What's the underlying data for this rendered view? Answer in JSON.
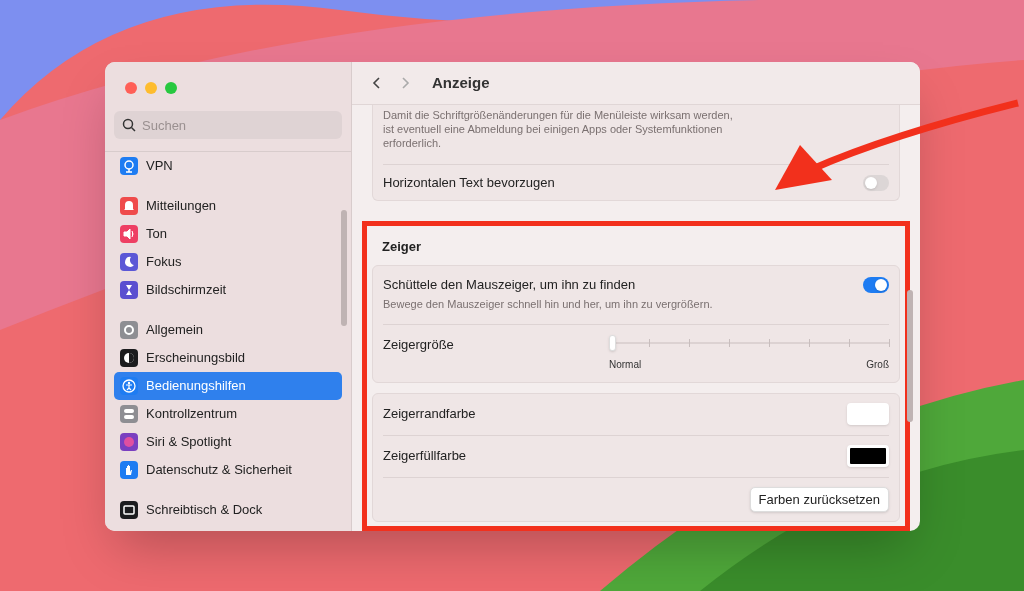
{
  "window": {
    "title": "Anzeige"
  },
  "search": {
    "placeholder": "Suchen"
  },
  "sidebar": {
    "groups": [
      [
        {
          "label": "VPN",
          "color": "#1e7cf2",
          "selected": false
        }
      ],
      [
        {
          "label": "Mitteilungen",
          "color": "#ef4b4b",
          "selected": false
        },
        {
          "label": "Ton",
          "color": "#ee3f63",
          "selected": false
        },
        {
          "label": "Fokus",
          "color": "#5b57d6",
          "selected": false
        },
        {
          "label": "Bildschirmzeit",
          "color": "#5b4fd0",
          "selected": false
        }
      ],
      [
        {
          "label": "Allgemein",
          "color": "#8e8e93",
          "selected": false
        },
        {
          "label": "Erscheinungsbild",
          "color": "#1c1c1e",
          "selected": false
        },
        {
          "label": "Bedienungshilfen",
          "color": "#1e7cf2",
          "selected": true
        },
        {
          "label": "Kontrollzentrum",
          "color": "#8e8e93",
          "selected": false
        },
        {
          "label": "Siri & Spotlight",
          "color": "#7a3fc0",
          "selected": false
        },
        {
          "label": "Datenschutz & Sicherheit",
          "color": "#1e7cf2",
          "selected": false
        }
      ],
      [
        {
          "label": "Schreibtisch & Dock",
          "color": "#1c1c1e",
          "selected": false
        }
      ]
    ]
  },
  "top_card": {
    "note": "Damit die Schriftgrößenänderungen für die Menüleiste wirksam werden, ist eventuell eine Abmeldung bei einigen Apps oder Systemfunktionen erforderlich.",
    "toggle": {
      "label": "Horizontalen Text bevorzugen",
      "on": false
    }
  },
  "pointer_section": {
    "title": "Zeiger",
    "shake": {
      "label": "Schüttele den Mauszeiger, um ihn zu finden",
      "description": "Bewege den Mauszeiger schnell hin und her, um ihn zu vergrößern.",
      "on": true
    },
    "size": {
      "label": "Zeigergröße",
      "level": 0,
      "min_label": "Normal",
      "max_label": "Groß"
    },
    "colors": [
      {
        "label": "Zeigerrandfarbe",
        "color": "#ffffff"
      },
      {
        "label": "Zeigerfüllfarbe",
        "color": "#000000"
      }
    ],
    "reset_button": "Farben zurücksetzen"
  }
}
